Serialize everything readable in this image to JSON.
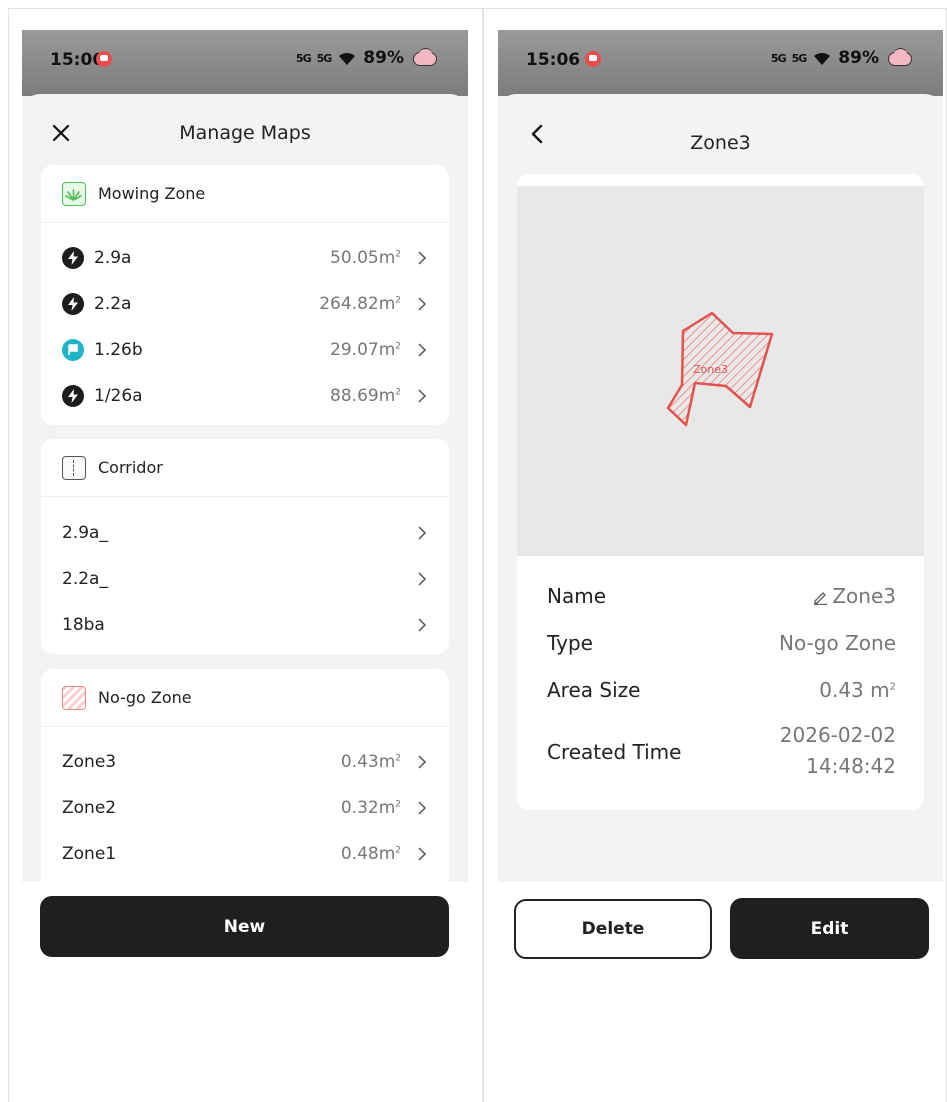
{
  "status_bar": {
    "time": "15:06",
    "signal1": "5G",
    "signal2": "5G",
    "battery": "89%"
  },
  "left_screen": {
    "title": "Manage Maps",
    "sections": {
      "mowing": {
        "label": "Mowing Zone",
        "items": [
          {
            "name": "2.9a",
            "value": "50.05m",
            "unit_sup": "2",
            "badge": "lightning-icon"
          },
          {
            "name": "2.2a",
            "value": "264.82m",
            "unit_sup": "2",
            "badge": "lightning-icon"
          },
          {
            "name": "1.26b",
            "value": "29.07m",
            "unit_sup": "2",
            "badge": "flag-icon"
          },
          {
            "name": "1/26a",
            "value": "88.69m",
            "unit_sup": "2",
            "badge": "lightning-icon"
          }
        ]
      },
      "corridor": {
        "label": "Corridor",
        "items": [
          {
            "name": "2.9a_"
          },
          {
            "name": "2.2a_"
          },
          {
            "name": "18ba"
          }
        ]
      },
      "nogo": {
        "label": "No-go Zone",
        "items": [
          {
            "name": "Zone3",
            "value": "0.43m",
            "unit_sup": "2"
          },
          {
            "name": "Zone2",
            "value": "0.32m",
            "unit_sup": "2"
          },
          {
            "name": "Zone1",
            "value": "0.48m",
            "unit_sup": "2"
          }
        ]
      }
    },
    "new_button": "New"
  },
  "right_screen": {
    "title": "Zone3",
    "map_label": "Zone3",
    "details": {
      "name_label": "Name",
      "name_value": "Zone3",
      "type_label": "Type",
      "type_value": "No-go Zone",
      "area_label": "Area Size",
      "area_value": "0.43 m",
      "area_sup": "2",
      "created_label": "Created Time",
      "created_date": "2026-02-02",
      "created_time": "14:48:42"
    },
    "delete_button": "Delete",
    "edit_button": "Edit"
  },
  "colors": {
    "primary_button": "#1f1f1f",
    "nogo_red": "#e2534f",
    "mowing_green": "#4cbf5a",
    "flag_teal": "#1fb5c7"
  }
}
